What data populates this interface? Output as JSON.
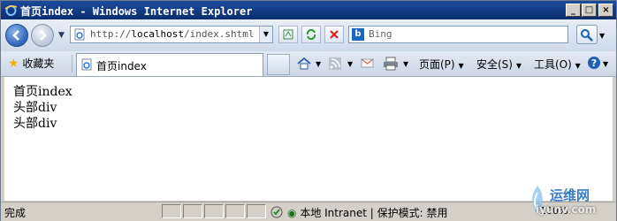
{
  "window": {
    "title": "首页index - Windows Internet Explorer",
    "controls": {
      "minimize": "_",
      "maximize": "□",
      "close": "×"
    }
  },
  "address_bar": {
    "url_prefix": "http://",
    "url_host": "localhost",
    "url_path": "/index.shtml",
    "search_placeholder": "Bing",
    "icons": [
      "back-icon",
      "forward-icon",
      "compat-view-icon",
      "refresh-icon",
      "stop-icon",
      "search-go-icon"
    ]
  },
  "tabs_row": {
    "favorites_label": "收藏夹",
    "active_tab": "首页index",
    "commands": {
      "page": "页面(P)",
      "safety": "安全(S)",
      "tools": "工具(O)"
    }
  },
  "content": {
    "lines": [
      "首页index",
      "头部div",
      "头部div"
    ]
  },
  "status_bar": {
    "status_text": "完成",
    "zone_text": "本地 Intranet | 保护模式: 禁用",
    "zoom": "100%"
  },
  "watermark": {
    "line1": "运维网",
    "line2": "iyunv.com"
  },
  "colors": {
    "title_bar": "#1c4b9c",
    "chrome": "#d4d0c8",
    "content_bg": "#ffffff"
  }
}
